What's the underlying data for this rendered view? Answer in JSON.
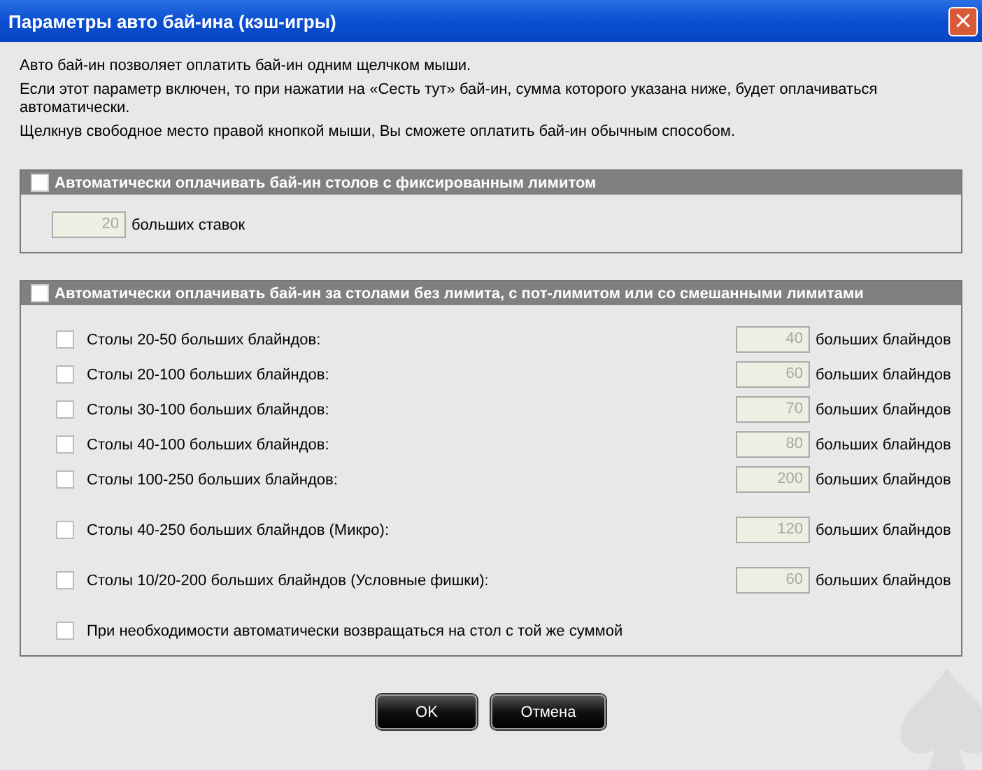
{
  "window": {
    "title": "Параметры авто бай-ина (кэш-игры)",
    "close": "×"
  },
  "intro": [
    "Авто бай-ин позволяет оплатить бай-ин одним щелчком мыши.",
    "Если этот параметр включен, то при нажатии на «Сесть тут» бай-ин, сумма которого указана ниже, будет оплачиваться автоматически.",
    "Щелкнув свободное место правой кнопкой мыши, Вы сможете оплатить бай-ин обычным способом."
  ],
  "fixed_limit": {
    "label": "Автоматически оплачивать бай-ин столов с фиксированным лимитом",
    "checked": false,
    "amount": "20",
    "unit": "больших ставок"
  },
  "no_limit": {
    "label": "Автоматически оплачивать бай-ин за столами без лимита, с пот-лимитом или со смешанными лимитами",
    "checked": false,
    "groups": [
      {
        "rows": [
          {
            "kind": "amount",
            "label": "Столы 20-50 больших блайндов:",
            "checked": false,
            "amount": "40",
            "unit": "больших блайндов"
          },
          {
            "kind": "amount",
            "label": "Столы 20-100 больших блайндов:",
            "checked": false,
            "amount": "60",
            "unit": "больших блайндов"
          },
          {
            "kind": "amount",
            "label": "Столы 30-100 больших блайндов:",
            "checked": false,
            "amount": "70",
            "unit": "больших блайндов"
          },
          {
            "kind": "amount",
            "label": "Столы 40-100 больших блайндов:",
            "checked": false,
            "amount": "80",
            "unit": "больших блайндов"
          },
          {
            "kind": "amount",
            "label": "Столы 100-250 больших блайндов:",
            "checked": false,
            "amount": "200",
            "unit": "больших блайндов"
          }
        ]
      },
      {
        "rows": [
          {
            "kind": "amount",
            "label": "Столы 40-250 больших блайндов (Микро):",
            "checked": false,
            "amount": "120",
            "unit": "больших блайндов"
          }
        ]
      },
      {
        "rows": [
          {
            "kind": "amount",
            "label": "Столы 10/20-200 больших блайндов (Условные фишки):",
            "checked": false,
            "amount": "60",
            "unit": "больших блайндов"
          }
        ]
      },
      {
        "rows": [
          {
            "kind": "option",
            "label": "При необходимости автоматически возвращаться на стол с той же суммой",
            "checked": false
          }
        ]
      }
    ]
  },
  "buttons": [
    "OK",
    "Отмена"
  ]
}
